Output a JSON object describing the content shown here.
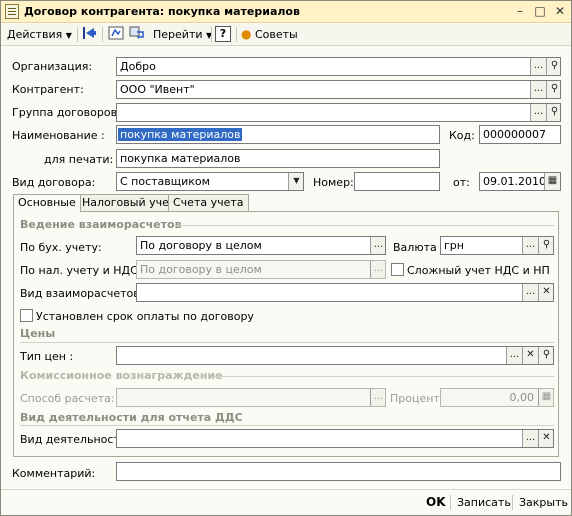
{
  "window": {
    "title": "Договор контрагента: покупка материалов"
  },
  "toolbar": {
    "actions": "Действия",
    "goto": "Перейти",
    "help": "?",
    "tips": "Советы"
  },
  "form": {
    "org_label": "Организация:",
    "org_value": "Добро",
    "contractor_label": "Контрагент:",
    "contractor_value": "ООО \"Ивент\"",
    "group_label": "Группа договоров:",
    "group_value": "",
    "name_label": "Наименование :",
    "name_value": "покупка материалов",
    "code_label": "Код:",
    "code_value": "000000007",
    "print_label": "для печати:",
    "print_value": "покупка материалов",
    "type_label": "Вид договора:",
    "type_value": "С поставщиком",
    "number_label": "Номер:",
    "number_value": "",
    "from_label": "от:",
    "date_value": "09.01.2010"
  },
  "tabs": [
    {
      "label": "Основные",
      "active": true
    },
    {
      "label": "Налоговый учет",
      "active": false
    },
    {
      "label": "Счета учета",
      "active": false
    }
  ],
  "panel": {
    "settlements_header": "Ведение взаиморасчетов",
    "acc_label": "По бух. учету:",
    "acc_value": "По договору в целом",
    "currency_label": "Валюта :",
    "currency_value": "грн",
    "tax_label": "По нал. учету и НДС:",
    "tax_value": "По договору в целом",
    "complex_vat_label": "Сложный  учет НДС и НП",
    "settle_type_label": "Вид взаиморасчетов:",
    "settle_type_value": "",
    "payment_term_label": "Установлен срок оплаты по договору",
    "prices_header": "Цены",
    "price_type_label": "Тип цен :",
    "price_type_value": "",
    "commission_header": "Комиссионное вознаграждение",
    "calc_method_label": "Способ расчета:",
    "calc_method_value": "",
    "percent_label": "Процент:",
    "percent_value": "0,00",
    "activity_header": "Вид деятельности для отчета ДДС",
    "activity_label": "Вид деятельности:",
    "activity_value": ""
  },
  "comment": {
    "label": "Комментарий:",
    "value": ""
  },
  "footer": {
    "ok": "OK",
    "save": "Записать",
    "close": "Закрыть"
  }
}
